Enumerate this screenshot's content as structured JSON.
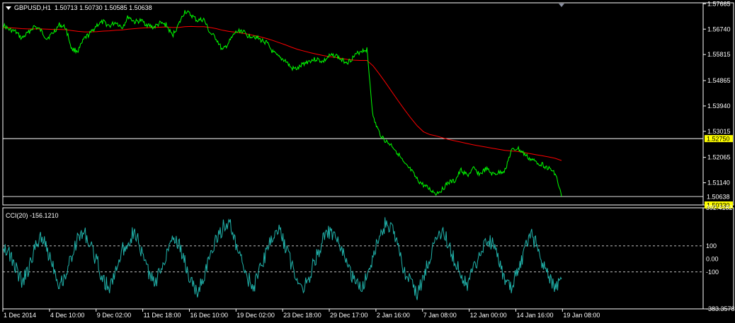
{
  "header": {
    "symbol": "GBPUSD,H1",
    "ohlc": "1.50713 1.50730 1.50585 1.50638"
  },
  "cci_header": {
    "label": "CCI(20)",
    "value": "-156.1210"
  },
  "colors": {
    "background": "#000000",
    "price_line": "#00ff00",
    "moving_average": "#ff0000",
    "cci_line": "#20b2aa",
    "grid": "#ffffff",
    "highlight_label": "#ffff00"
  },
  "chart_data": [
    {
      "type": "line",
      "panel": "price",
      "ylim": [
        1.5033,
        1.577
      ],
      "yticks": [
        "1.57665",
        "1.56740",
        "1.55815",
        "1.54865",
        "1.53940",
        "1.53015",
        "1.52065",
        "1.51140",
        "1.50638"
      ],
      "ytick_values": [
        1.57665,
        1.5674,
        1.55815,
        1.54865,
        1.5394,
        1.53015,
        1.52065,
        1.5114,
        1.50638
      ],
      "horizontal_lines": [
        {
          "value": 1.5275,
          "label": "1.52750",
          "highlight": true
        },
        {
          "value": 1.50638,
          "label": "1.50638",
          "highlight": false
        },
        {
          "value": 1.5033,
          "label": "1.50330",
          "highlight": true
        }
      ],
      "series": [
        {
          "values": [
            1.569,
            1.5672,
            1.5665,
            1.564,
            1.566,
            1.5685,
            1.567,
            1.564,
            1.566,
            1.569,
            1.568,
            1.56,
            1.5595,
            1.564,
            1.566,
            1.569,
            1.57,
            1.5685,
            1.57,
            1.568,
            1.572,
            1.57,
            1.5705,
            1.569,
            1.568,
            1.5695,
            1.569,
            1.565,
            1.569,
            1.574,
            1.5725,
            1.5705,
            1.571,
            1.566,
            1.564,
            1.5595,
            1.5625,
            1.566,
            1.567,
            1.565,
            1.565,
            1.5635,
            1.5625,
            1.559,
            1.557,
            1.556,
            1.553,
            1.553,
            1.555,
            1.556,
            1.5565,
            1.5555,
            1.5575,
            1.558,
            1.556,
            1.5555,
            1.5575,
            1.5595,
            1.56,
            1.535,
            1.5295,
            1.5265,
            1.525,
            1.522,
            1.518,
            1.516,
            1.5125,
            1.5105,
            1.509,
            1.5075,
            1.509,
            1.5115,
            1.512,
            1.516,
            1.514,
            1.5165,
            1.5145,
            1.5165,
            1.5145,
            1.515,
            1.516,
            1.523,
            1.524,
            1.522,
            1.52,
            1.519,
            1.518,
            1.5165,
            1.515,
            1.5064
          ]
        },
        {
          "name": "moving-average",
          "values": [
            1.568,
            1.5679,
            1.5678,
            1.5676,
            1.5675,
            1.5675,
            1.5675,
            1.5674,
            1.5673,
            1.5673,
            1.5672,
            1.5669,
            1.5666,
            1.5664,
            1.5664,
            1.5665,
            1.5667,
            1.5668,
            1.567,
            1.5671,
            1.5674,
            1.5676,
            1.5678,
            1.5679,
            1.568,
            1.5681,
            1.5682,
            1.568,
            1.568,
            1.5683,
            1.5684,
            1.5683,
            1.5683,
            1.568,
            1.5676,
            1.567,
            1.5666,
            1.5663,
            1.566,
            1.5656,
            1.5651,
            1.5646,
            1.564,
            1.5633,
            1.5625,
            1.5617,
            1.5608,
            1.56,
            1.5594,
            1.5588,
            1.5583,
            1.5578,
            1.5574,
            1.5571,
            1.5567,
            1.5563,
            1.5561,
            1.556,
            1.556,
            1.554,
            1.551,
            1.5478,
            1.5445,
            1.5412,
            1.538,
            1.535,
            1.5322,
            1.53,
            1.529,
            1.5285,
            1.5278,
            1.5272,
            1.5267,
            1.5262,
            1.5257,
            1.5252,
            1.5248,
            1.5244,
            1.524,
            1.5236,
            1.5232,
            1.523,
            1.5228,
            1.5224,
            1.522,
            1.5216,
            1.5212,
            1.5208,
            1.5203,
            1.5195
          ]
        }
      ]
    },
    {
      "type": "line",
      "panel": "indicator",
      "ylim": [
        -383.3578,
        392.4182
      ],
      "yticks": [
        "392.4182",
        "100",
        "0.00",
        "-100",
        "-383.3578"
      ],
      "ytick_values": [
        392.4182,
        100,
        0,
        -100,
        -383.3578
      ],
      "reference_levels": [
        100,
        -100
      ],
      "series": [
        {
          "name": "CCI(20)",
          "values": [
            120,
            40,
            -60,
            -180,
            -90,
            60,
            190,
            80,
            -40,
            -200,
            -120,
            30,
            160,
            210,
            90,
            -20,
            -160,
            -230,
            -80,
            60,
            140,
            220,
            60,
            -70,
            -190,
            -110,
            40,
            180,
            120,
            -30,
            -180,
            -260,
            -130,
            10,
            150,
            240,
            290,
            120,
            -20,
            -150,
            -210,
            -80,
            60,
            170,
            230,
            100,
            -40,
            -160,
            -220,
            -110,
            20,
            140,
            210,
            150,
            60,
            -60,
            -170,
            -240,
            -120,
            30,
            160,
            280,
            230,
            70,
            -90,
            -190,
            -260,
            -150,
            10,
            150,
            210,
            120,
            -20,
            -130,
            -200,
            -80,
            40,
            160,
            110,
            -30,
            -160,
            -220,
            -100,
            50,
            200,
            110,
            -40,
            -150,
            -200,
            -156
          ]
        }
      ],
      "x": [
        "1 Dec 2014",
        "4 Dec 10:00",
        "9 Dec 02:00",
        "11 Dec 18:00",
        "16 Dec 10:00",
        "19 Dec 02:00",
        "23 Dec 18:00",
        "29 Dec 17:00",
        "2 Jan 16:00",
        "7 Jan 08:00",
        "12 Jan 00:00",
        "14 Jan 16:00",
        "19 Jan 08:00"
      ]
    }
  ]
}
